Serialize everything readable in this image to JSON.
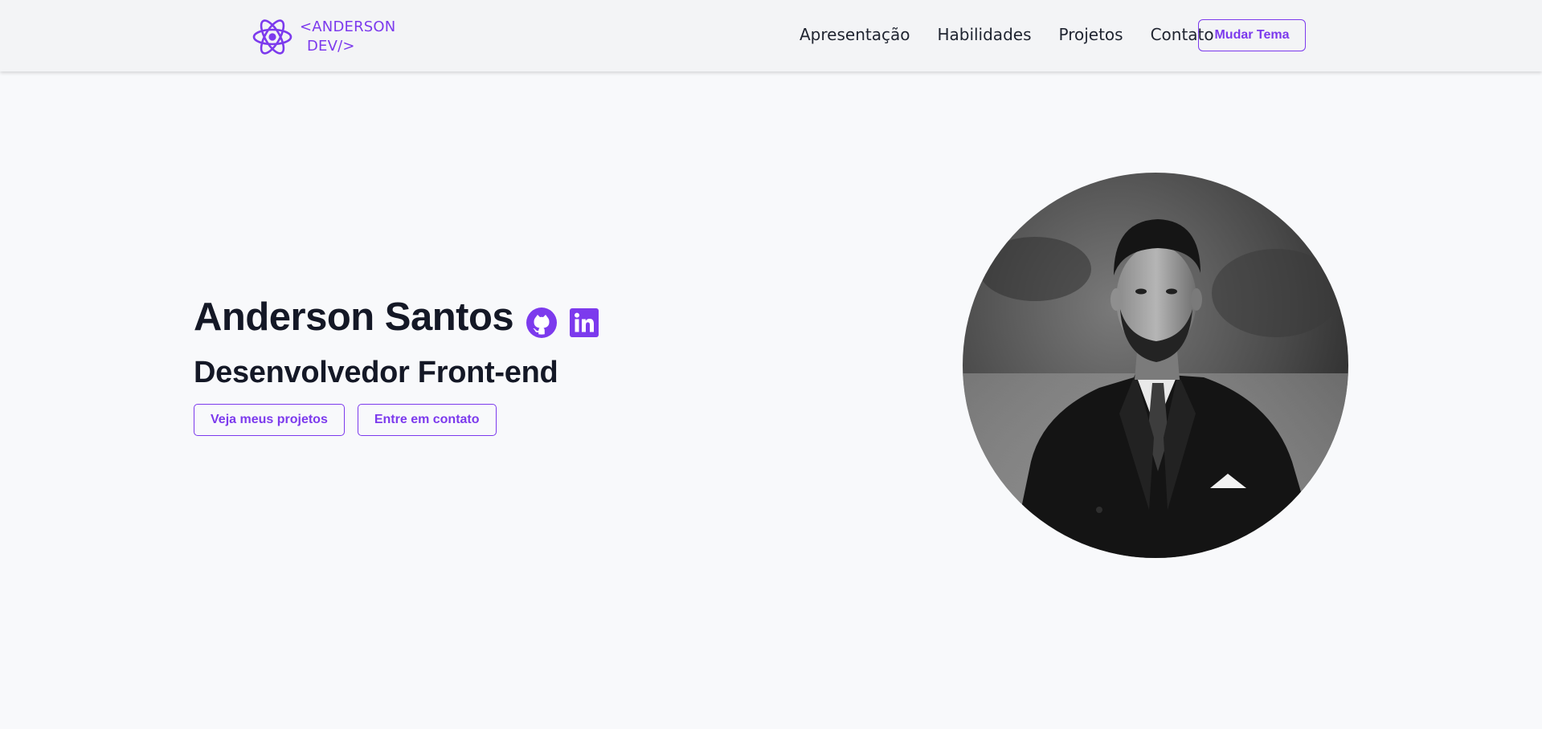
{
  "header": {
    "logo": {
      "icon": "react-atom-icon",
      "line1": "<ANDERSON",
      "line2": "DEV/>"
    },
    "nav": [
      {
        "label": "Apresentação"
      },
      {
        "label": "Habilidades"
      },
      {
        "label": "Projetos"
      },
      {
        "label": "Contato"
      }
    ],
    "theme_button": "Mudar Tema"
  },
  "hero": {
    "name": "Anderson Santos",
    "role": "Desenvolvedor Front-end",
    "social": [
      {
        "icon": "github-icon"
      },
      {
        "icon": "linkedin-icon"
      }
    ],
    "buttons": [
      {
        "label": "Veja meus projetos"
      },
      {
        "label": "Entre em contato"
      }
    ],
    "photo": {
      "style": "grayscale circular portrait"
    }
  },
  "colors": {
    "accent": "#7c3aed",
    "background": "#f8f9fb",
    "header_bg": "#f3f4f6",
    "text": "#141826"
  }
}
